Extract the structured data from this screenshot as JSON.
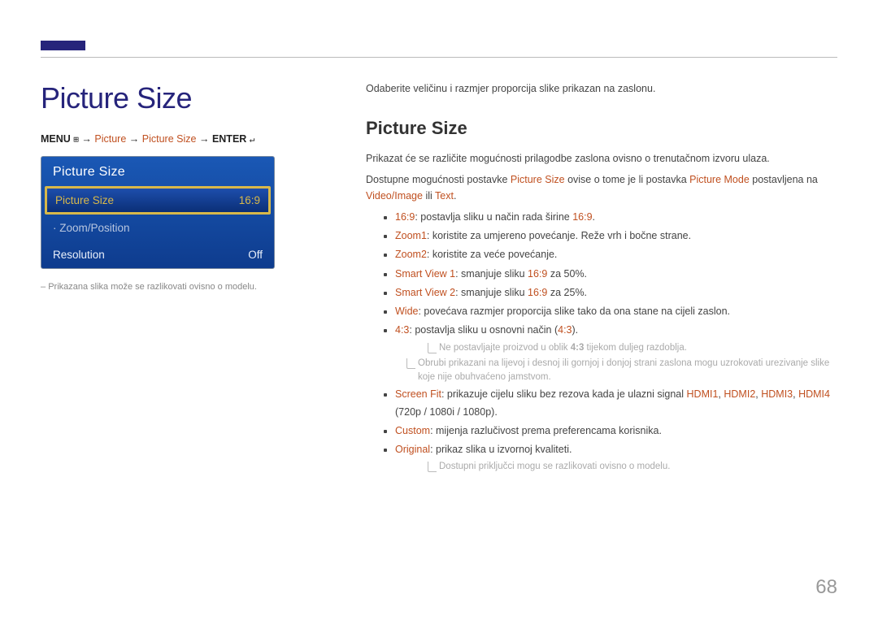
{
  "tabMark": "",
  "pageTitle": "Picture Size",
  "breadcrumb": {
    "menu": "MENU",
    "menuIcon": "⊞",
    "arrow": " → ",
    "picture": "Picture",
    "pictureSize": "Picture Size",
    "enter": "ENTER",
    "enterIcon": "↵"
  },
  "osd": {
    "title": "Picture Size",
    "row1": {
      "label": "Picture Size",
      "value": "16:9"
    },
    "row2": {
      "label": "·  Zoom/Position",
      "value": ""
    },
    "row3": {
      "label": "Resolution",
      "value": "Off"
    }
  },
  "leftNote": "Prikazana slika može se razlikovati ovisno o modelu.",
  "right": {
    "intro": "Odaberite veličinu i razmjer proporcija slike prikazan na zaslonu.",
    "secTitle": "Picture Size",
    "p1": "Prikazat će se različite mogućnosti prilagodbe zaslona ovisno o trenutačnom izvoru ulaza.",
    "p2a": "Dostupne mogućnosti postavke ",
    "p2k1": "Picture Size",
    "p2b": " ovise o tome je li postavka ",
    "p2k2": "Picture Mode",
    "p2c": " postavljena na ",
    "p2k3": "Video/Image",
    "p2d": " ili ",
    "p2k4": "Text",
    "p2e": ".",
    "b1a": "16:9",
    "b1b": ": postavlja sliku u način rada širine ",
    "b1c": "16:9",
    "b1d": ".",
    "b2a": "Zoom1",
    "b2b": ": koristite za umjereno povećanje. Reže vrh i bočne strane.",
    "b3a": "Zoom2",
    "b3b": ": koristite za veće povećanje.",
    "b4a": "Smart View 1",
    "b4b": ": smanjuje sliku ",
    "b4c": "16:9",
    "b4d": " za 50%.",
    "b5a": "Smart View 2",
    "b5b": ": smanjuje sliku ",
    "b5c": "16:9",
    "b5d": " za 25%.",
    "b6a": "Wide",
    "b6b": ": povećava razmjer proporcija slike tako da ona stane na cijeli zaslon.",
    "b7a": "4:3",
    "b7b": ": postavlja sliku u osnovni način (",
    "b7c": "4:3",
    "b7d": ").",
    "n7a": "Ne postavljajte proizvod u oblik ",
    "n7ak": "4:3",
    "n7a2": " tijekom duljeg razdoblja.",
    "n7b": "Obrubi prikazani na lijevoj i desnoj ili gornjoj i donjoj strani zaslona mogu uzrokovati urezivanje slike koje nije obuhvaćeno jamstvom.",
    "b8a": "Screen Fit",
    "b8b": ": prikazuje cijelu sliku bez rezova kada je ulazni signal ",
    "b8c": "HDMI1",
    "b8d": ", ",
    "b8e": "HDMI2",
    "b8f": ", ",
    "b8g": "HDMI3",
    "b8h": ", ",
    "b8i": "HDMI4",
    "b8j": " (720p / 1080i / 1080p).",
    "b9a": "Custom",
    "b9b": ": mijenja razlučivost prema preferencama korisnika.",
    "b10a": "Original",
    "b10b": ": prikaz slika u izvornoj kvaliteti.",
    "nEnd": "Dostupni priključci mogu se razlikovati ovisno o modelu."
  },
  "pageNum": "68"
}
